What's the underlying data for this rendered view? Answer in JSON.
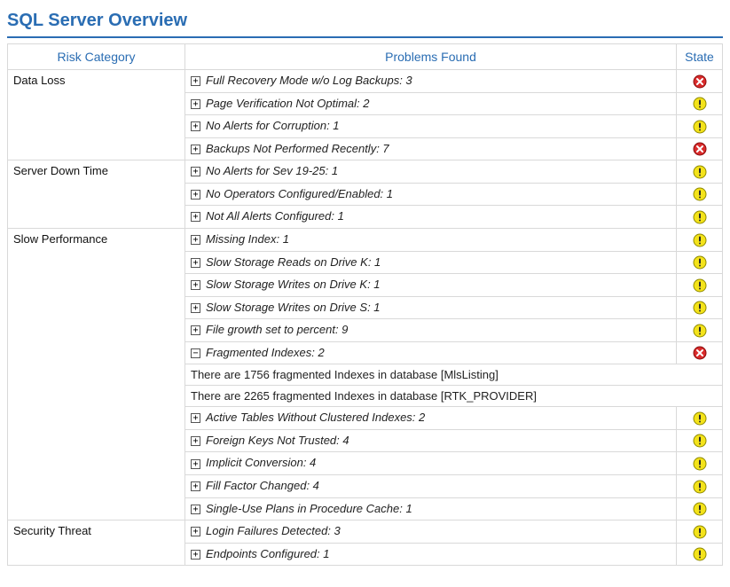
{
  "title": "SQL Server Overview",
  "columns": {
    "risk": "Risk Category",
    "problems": "Problems Found",
    "state": "State"
  },
  "states": {
    "warn": "warn",
    "error": "error"
  },
  "icons": {
    "plus": "+",
    "minus": "−"
  },
  "categories": [
    {
      "name": "Data Loss",
      "rows": [
        {
          "type": "item",
          "expanded": false,
          "label": "Full Recovery Mode w/o Log Backups: 3",
          "state": "error"
        },
        {
          "type": "item",
          "expanded": false,
          "label": "Page Verification Not Optimal: 2",
          "state": "warn"
        },
        {
          "type": "item",
          "expanded": false,
          "label": "No Alerts for Corruption: 1",
          "state": "warn"
        },
        {
          "type": "item",
          "expanded": false,
          "label": "Backups Not Performed Recently: 7",
          "state": "error"
        }
      ]
    },
    {
      "name": "Server Down Time",
      "rows": [
        {
          "type": "item",
          "expanded": false,
          "label": "No Alerts for Sev 19-25: 1",
          "state": "warn"
        },
        {
          "type": "item",
          "expanded": false,
          "label": "No Operators Configured/Enabled: 1",
          "state": "warn"
        },
        {
          "type": "item",
          "expanded": false,
          "label": "Not All Alerts Configured: 1",
          "state": "warn"
        }
      ]
    },
    {
      "name": "Slow Performance",
      "rows": [
        {
          "type": "item",
          "expanded": false,
          "label": "Missing Index: 1",
          "state": "warn"
        },
        {
          "type": "item",
          "expanded": false,
          "label": "Slow Storage Reads on Drive K: 1",
          "state": "warn"
        },
        {
          "type": "item",
          "expanded": false,
          "label": "Slow Storage Writes on Drive K: 1",
          "state": "warn"
        },
        {
          "type": "item",
          "expanded": false,
          "label": "Slow Storage Writes on Drive S: 1",
          "state": "warn"
        },
        {
          "type": "item",
          "expanded": false,
          "label": "File growth set to percent: 9",
          "state": "warn"
        },
        {
          "type": "item",
          "expanded": true,
          "label": "Fragmented Indexes: 2",
          "state": "error"
        },
        {
          "type": "detail",
          "label": "There are 1756 fragmented Indexes in database [MlsListing]"
        },
        {
          "type": "detail",
          "label": "There are 2265 fragmented Indexes in database [RTK_PROVIDER]"
        },
        {
          "type": "item",
          "expanded": false,
          "label": "Active Tables Without Clustered Indexes: 2",
          "state": "warn"
        },
        {
          "type": "item",
          "expanded": false,
          "label": "Foreign Keys Not Trusted: 4",
          "state": "warn"
        },
        {
          "type": "item",
          "expanded": false,
          "label": "Implicit Conversion: 4",
          "state": "warn"
        },
        {
          "type": "item",
          "expanded": false,
          "label": "Fill Factor Changed: 4",
          "state": "warn"
        },
        {
          "type": "item",
          "expanded": false,
          "label": "Single-Use Plans in Procedure Cache: 1",
          "state": "warn"
        }
      ]
    },
    {
      "name": "Security Threat",
      "rows": [
        {
          "type": "item",
          "expanded": false,
          "label": "Login Failures Detected: 3",
          "state": "warn"
        },
        {
          "type": "item",
          "expanded": false,
          "label": "Endpoints Configured: 1",
          "state": "warn"
        }
      ]
    }
  ]
}
